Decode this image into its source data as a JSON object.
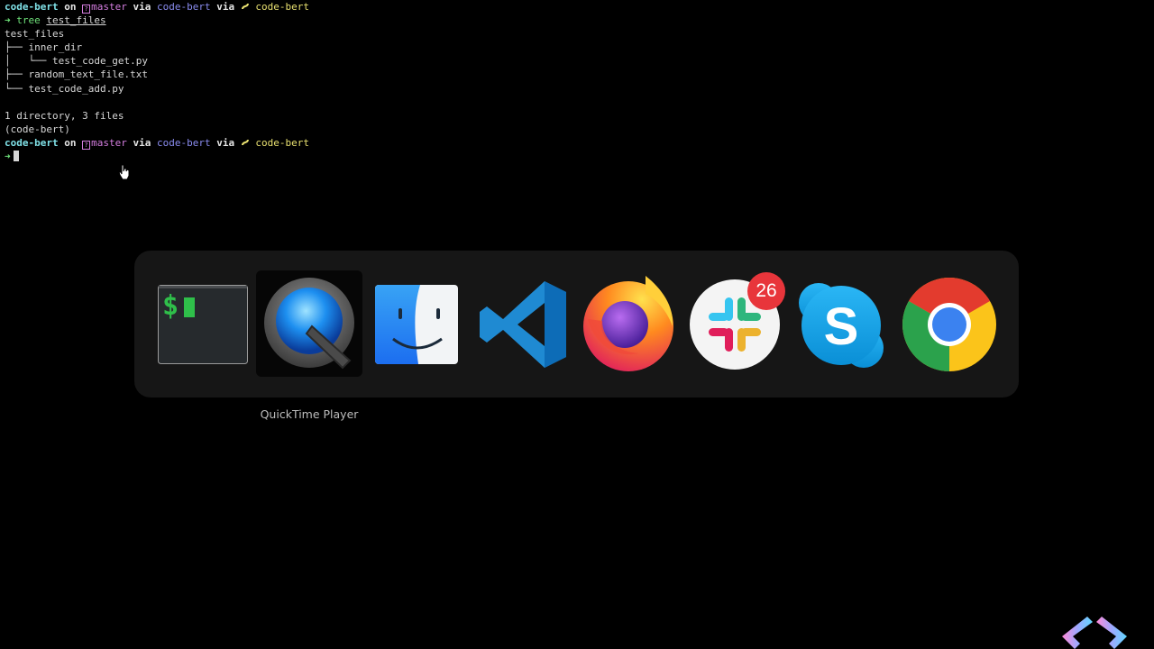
{
  "terminal": {
    "prompt1": {
      "dir": "code-bert",
      "on": " on ",
      "branch": "master",
      "via1": " via ",
      "env": "code-bert",
      "via2": " via ",
      "py": "code-bert"
    },
    "cmd_arrow": "➜",
    "cmd_name": "tree",
    "cmd_arg": "test_files",
    "tree_lines": [
      "test_files",
      "├── inner_dir",
      "│   └── test_code_get.py",
      "├── random_text_file.txt",
      "└── test_code_add.py"
    ],
    "summary": "1 directory, 3 files",
    "venv": "(code-bert)",
    "prompt2": {
      "dir": "code-bert",
      "on": " on ",
      "branch": "master",
      "via1": " via ",
      "env": "code-bert",
      "via2": " via ",
      "py": "code-bert"
    },
    "prompt_arrow": "➜"
  },
  "app_switcher": {
    "selected_label": "QuickTime Player",
    "apps": [
      {
        "name": "Terminal",
        "icon": "terminal-icon"
      },
      {
        "name": "QuickTime Player",
        "icon": "quicktime-icon"
      },
      {
        "name": "Finder",
        "icon": "finder-icon"
      },
      {
        "name": "Visual Studio Code",
        "icon": "vscode-icon"
      },
      {
        "name": "Firefox",
        "icon": "firefox-icon"
      },
      {
        "name": "Slack",
        "icon": "slack-icon",
        "badge": "26"
      },
      {
        "name": "Skype",
        "icon": "skype-icon"
      },
      {
        "name": "Google Chrome",
        "icon": "chrome-icon"
      }
    ],
    "terminal_icon_glyph": "$"
  },
  "colors": {
    "background": "#000000",
    "switcher_bg": "#161616",
    "badge": "#e8353b"
  }
}
